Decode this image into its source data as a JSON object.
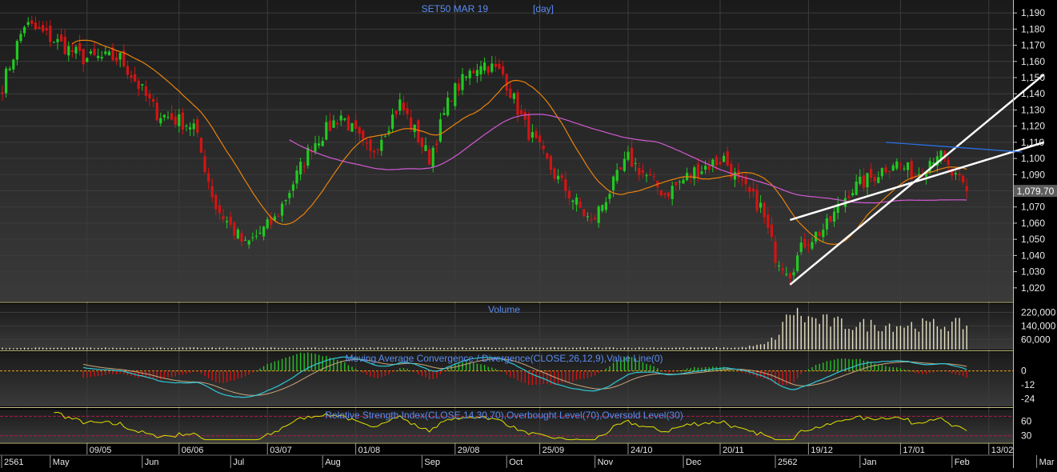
{
  "chart_data": {
    "type": "candlestick",
    "title": "SET50 MAR 19",
    "title_suffix": "[day]",
    "last_price_label": "1,079.70",
    "last_price": 1079.7,
    "price_axis": {
      "ylim": [
        1012,
        1196
      ],
      "ticks": [
        1020,
        1030,
        1040,
        1050,
        1060,
        1070,
        1080,
        1090,
        1100,
        1110,
        1120,
        1130,
        1140,
        1150,
        1160,
        1170,
        1180,
        1190
      ],
      "tick_labels": [
        "1,020",
        "1,030",
        "1,040",
        "1,050",
        "1,060",
        "1,070",
        "1,080",
        "1,090",
        "1,100",
        "1,110",
        "1,120",
        "1,130",
        "1,140",
        "1,150",
        "1,160",
        "1,170",
        "1,180",
        "1,190"
      ]
    },
    "price_anchors": [
      {
        "i": 0,
        "c": 1145
      },
      {
        "i": 6,
        "c": 1183
      },
      {
        "i": 12,
        "c": 1176
      },
      {
        "i": 22,
        "c": 1162
      },
      {
        "i": 32,
        "c": 1162
      },
      {
        "i": 42,
        "c": 1128
      },
      {
        "i": 52,
        "c": 1120
      },
      {
        "i": 58,
        "c": 1070
      },
      {
        "i": 66,
        "c": 1046
      },
      {
        "i": 74,
        "c": 1062
      },
      {
        "i": 84,
        "c": 1108
      },
      {
        "i": 92,
        "c": 1127
      },
      {
        "i": 100,
        "c": 1102
      },
      {
        "i": 108,
        "c": 1134
      },
      {
        "i": 116,
        "c": 1100
      },
      {
        "i": 122,
        "c": 1140
      },
      {
        "i": 130,
        "c": 1160
      },
      {
        "i": 136,
        "c": 1152
      },
      {
        "i": 142,
        "c": 1120
      },
      {
        "i": 150,
        "c": 1090
      },
      {
        "i": 160,
        "c": 1060
      },
      {
        "i": 170,
        "c": 1100
      },
      {
        "i": 180,
        "c": 1078
      },
      {
        "i": 188,
        "c": 1092
      },
      {
        "i": 196,
        "c": 1100
      },
      {
        "i": 200,
        "c": 1085
      },
      {
        "i": 206,
        "c": 1070
      },
      {
        "i": 210,
        "c": 1040
      },
      {
        "i": 214,
        "c": 1030
      },
      {
        "i": 218,
        "c": 1048
      },
      {
        "i": 224,
        "c": 1058
      },
      {
        "i": 230,
        "c": 1080
      },
      {
        "i": 236,
        "c": 1088
      },
      {
        "i": 242,
        "c": 1098
      },
      {
        "i": 248,
        "c": 1090
      },
      {
        "i": 254,
        "c": 1104
      },
      {
        "i": 258,
        "c": 1090
      },
      {
        "i": 262,
        "c": 1079.7
      }
    ],
    "ma_series": [
      {
        "period": 20,
        "color": "#e8820c"
      },
      {
        "period": 60,
        "color": "#d25ad2",
        "start_index": 78
      }
    ],
    "trend_lines": [
      {
        "from": {
          "i": 214,
          "v": 1022
        },
        "to": {
          "i": 283,
          "v": 1152
        },
        "color": "#ffffff"
      },
      {
        "from": {
          "i": 214,
          "v": 1062
        },
        "to": {
          "i": 283,
          "v": 1110
        },
        "color": "#ffffff"
      },
      {
        "from": {
          "i": 240,
          "v": 1110
        },
        "to": {
          "i": 277,
          "v": 1104
        },
        "color": "#2a6fe0"
      }
    ],
    "volume": {
      "title": "Volume",
      "ylim": [
        0,
        260000
      ],
      "ticks": [
        60000,
        140000,
        220000
      ],
      "tick_labels": [
        "60,000",
        "140,000",
        "220,000"
      ],
      "anchors": [
        {
          "i": 0,
          "v": 10000
        },
        {
          "i": 200,
          "v": 12000
        },
        {
          "i": 207,
          "v": 30000
        },
        {
          "i": 211,
          "v": 90000
        },
        {
          "i": 214,
          "v": 240000
        },
        {
          "i": 218,
          "v": 190000
        },
        {
          "i": 230,
          "v": 150000
        },
        {
          "i": 262,
          "v": 150000
        }
      ]
    },
    "macd": {
      "title": "Moving Average Convergence / Divergence(CLOSE,26,12,9),Value Line(0)",
      "params": [
        26,
        12,
        9
      ],
      "value_line": 0,
      "ylim": [
        -30,
        8
      ],
      "ticks": [
        0,
        -12,
        -24
      ],
      "tick_labels": [
        "0",
        "-12",
        "-24"
      ],
      "colors": {
        "macd": "#2fc7d8",
        "signal": "#c9a67a",
        "pos": "#27c227",
        "neg": "#d21414",
        "zero": "#e6a21d"
      }
    },
    "rsi": {
      "title": "Relative Strength Index(CLOSE,14,30,70),Overbought Level(70),Oversold Level(30)",
      "period": 14,
      "overbought": 70,
      "oversold": 30,
      "ylim": [
        18,
        82
      ],
      "ticks": [
        60,
        30
      ],
      "tick_labels": [
        "60",
        "30"
      ],
      "color": "#e0e000"
    },
    "x_axis": {
      "top_row": [
        {
          "i": 23,
          "label": "09/05"
        },
        {
          "i": 48,
          "label": "06/06"
        },
        {
          "i": 72,
          "label": "03/07"
        },
        {
          "i": 96,
          "label": "01/08"
        },
        {
          "i": 123,
          "label": "29/08"
        },
        {
          "i": 146,
          "label": "25/09"
        },
        {
          "i": 170,
          "label": "24/10"
        },
        {
          "i": 195,
          "label": "20/11"
        },
        {
          "i": 219,
          "label": "19/12"
        },
        {
          "i": 244,
          "label": "17/01"
        },
        {
          "i": 268,
          "label": "13/02"
        }
      ],
      "bottom_row": [
        {
          "i": -5,
          "label": "2561"
        },
        {
          "i": 13,
          "label": "May"
        },
        {
          "i": 38,
          "label": "Jun"
        },
        {
          "i": 62,
          "label": "Jul"
        },
        {
          "i": 87,
          "label": "Aug"
        },
        {
          "i": 114,
          "label": "Sep"
        },
        {
          "i": 137,
          "label": "Oct"
        },
        {
          "i": 161,
          "label": "Nov"
        },
        {
          "i": 185,
          "label": "Dec"
        },
        {
          "i": 210,
          "label": "2562"
        },
        {
          "i": 233,
          "label": "Jan"
        },
        {
          "i": 258,
          "label": "Feb"
        },
        {
          "i": 281,
          "label": "Mar"
        }
      ]
    },
    "colors": {
      "up": "#22c922",
      "down": "#d21414",
      "text": "#e8e8e8",
      "title": "#5a8cf0",
      "background": "#000000"
    }
  }
}
